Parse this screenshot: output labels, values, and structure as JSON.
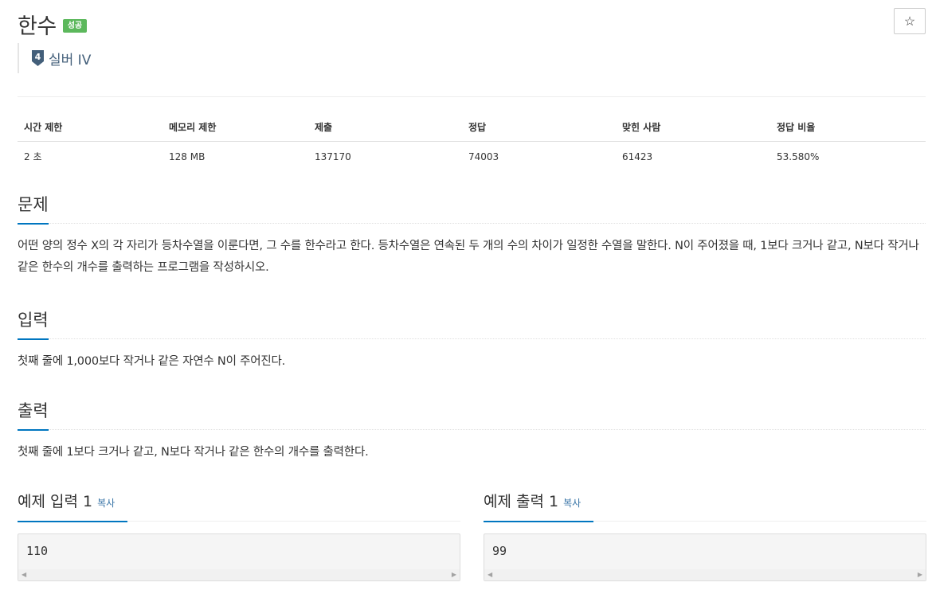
{
  "problem": {
    "title": "한수",
    "status_badge": "성공",
    "star_icon": "☆",
    "tier": {
      "level": "4",
      "label": "실버 IV",
      "color": "#435f7a"
    }
  },
  "stats": {
    "headers": [
      "시간 제한",
      "메모리 제한",
      "제출",
      "정답",
      "맞힌 사람",
      "정답 비율"
    ],
    "values": [
      "2 초",
      "128 MB",
      "137170",
      "74003",
      "61423",
      "53.580%"
    ]
  },
  "sections": {
    "description": {
      "heading": "문제",
      "text": "어떤 양의 정수 X의 각 자리가 등차수열을 이룬다면, 그 수를 한수라고 한다. 등차수열은 연속된 두 개의 수의 차이가 일정한 수열을 말한다. N이 주어졌을 때, 1보다 크거나 같고, N보다 작거나 같은 한수의 개수를 출력하는 프로그램을 작성하시오."
    },
    "input": {
      "heading": "입력",
      "text": "첫째 줄에 1,000보다 작거나 같은 자연수 N이 주어진다."
    },
    "output": {
      "heading": "출력",
      "text": "첫째 줄에 1보다 크거나 같고, N보다 작거나 같은 한수의 개수를 출력한다."
    }
  },
  "samples": {
    "input": {
      "heading": "예제 입력 1",
      "copy_label": "복사",
      "value": "110"
    },
    "output": {
      "heading": "예제 출력 1",
      "copy_label": "복사",
      "value": "99"
    }
  },
  "colors": {
    "accent": "#0076c0",
    "success": "#5cb85c",
    "link": "#3572a5"
  }
}
